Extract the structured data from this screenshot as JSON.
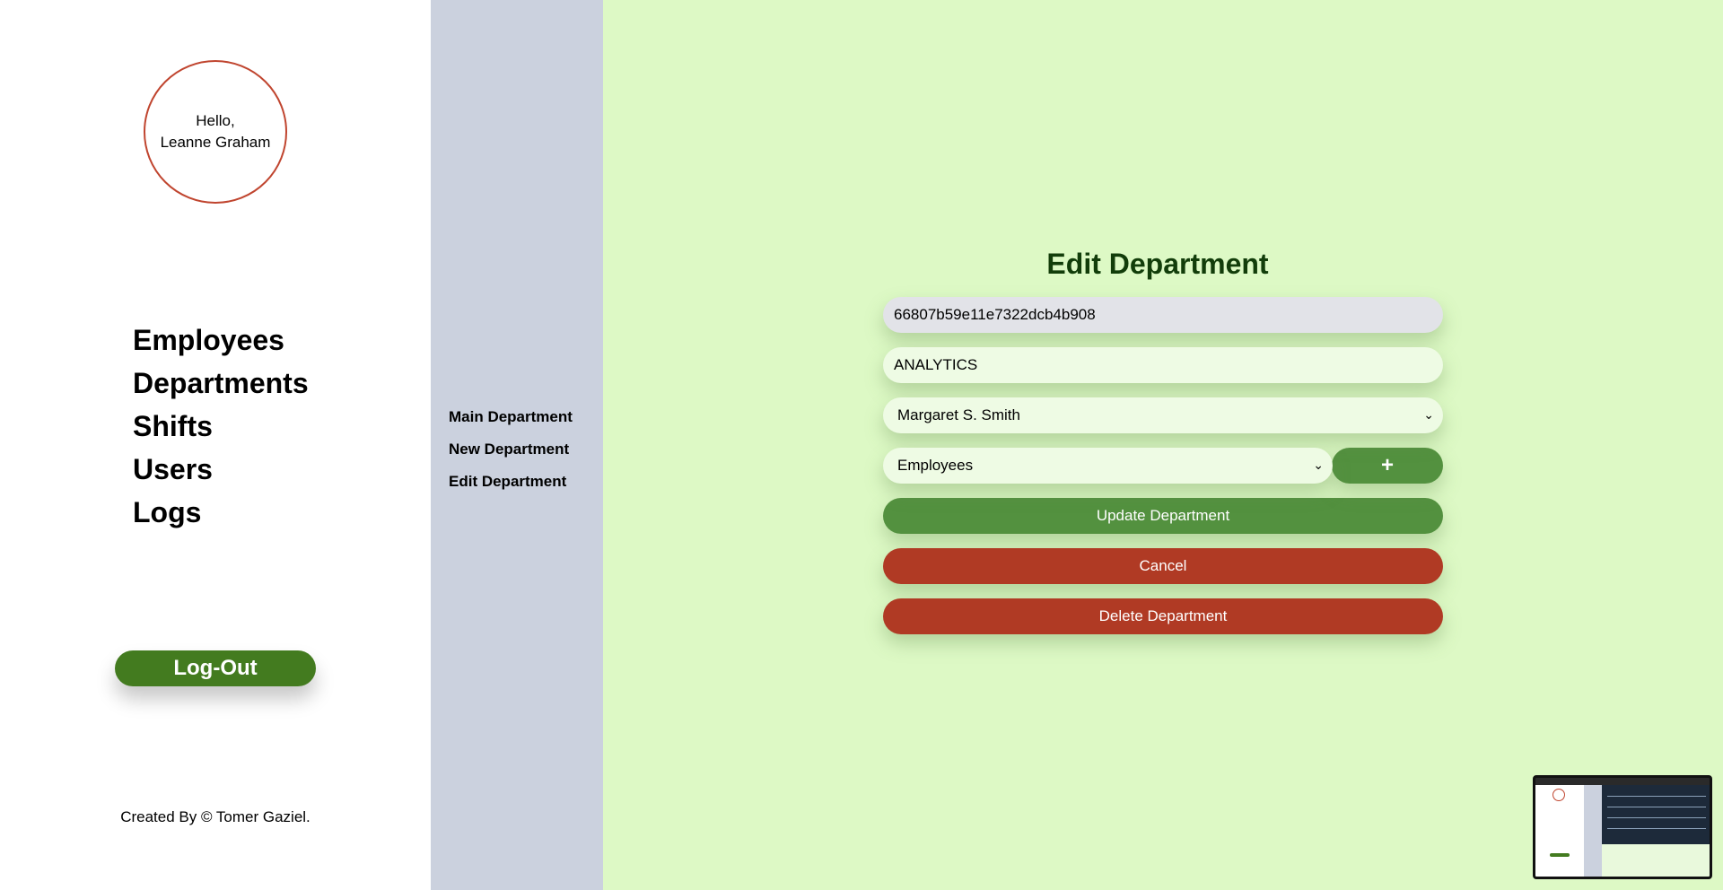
{
  "sidebar": {
    "greeting_line1": "Hello,",
    "greeting_line2": "Leanne Graham",
    "nav": {
      "employees": "Employees",
      "departments": "Departments",
      "shifts": "Shifts",
      "users": "Users",
      "logs": "Logs"
    },
    "logout_label": "Log-Out",
    "footer": "Created By © Tomer Gaziel."
  },
  "subnav": {
    "main_department": "Main Department",
    "new_department": "New Department",
    "edit_department": "Edit Department"
  },
  "form": {
    "title": "Edit Department",
    "id_value": "66807b59e11e7322dcb4b908",
    "name_value": "ANALYTICS",
    "manager_selected": "Margaret S. Smith",
    "employees_selected": "Employees",
    "add_icon": "plus-icon",
    "add_symbol": "+",
    "update_label": "Update Department",
    "cancel_label": "Cancel",
    "delete_label": "Delete Department"
  },
  "colors": {
    "accent_green": "#53913f",
    "logout_green": "#437b1f",
    "danger_red": "#b03a24",
    "main_bg": "#ddf9c5",
    "subnav_bg": "#cbd1de"
  }
}
